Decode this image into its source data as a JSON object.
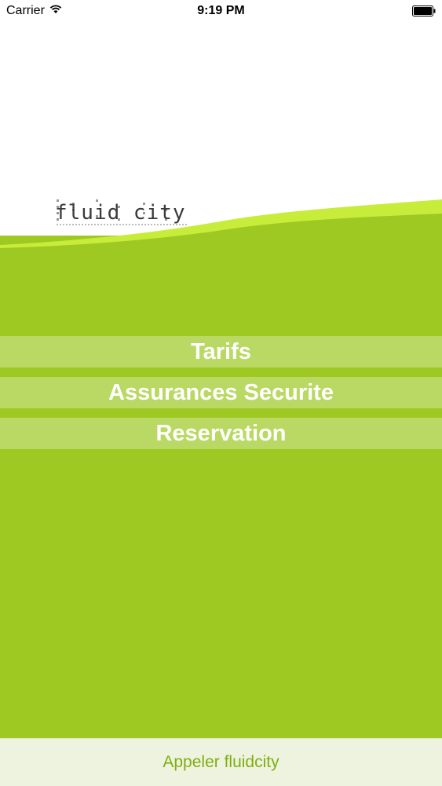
{
  "status_bar": {
    "carrier": "Carrier",
    "time": "9:19 PM",
    "wifi_icon": "wifi-icon",
    "battery_icon": "battery-icon"
  },
  "header": {
    "logo_text": "fluid city"
  },
  "menu": {
    "items": [
      {
        "label": "Tarifs"
      },
      {
        "label": "Assurances Securite"
      },
      {
        "label": "Reservation"
      }
    ]
  },
  "footer": {
    "call_label": "Appeler fluidcity"
  },
  "colors": {
    "background_green": "#9dc922",
    "header_white": "#ffffff",
    "wave_lime": "#c8ec3a",
    "footer_bg": "#eef3df",
    "footer_text": "#7fae10"
  }
}
